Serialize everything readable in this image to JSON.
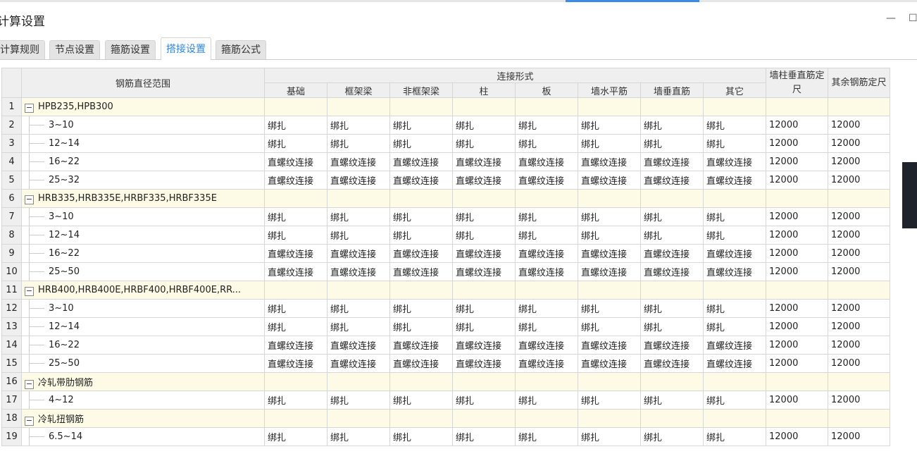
{
  "window": {
    "title": "计算设置",
    "minimize_icon": "minimize-icon",
    "maximize_icon": "maximize-icon"
  },
  "tabs": [
    {
      "label": "计算规则"
    },
    {
      "label": "节点设置"
    },
    {
      "label": "箍筋设置"
    },
    {
      "label": "搭接设置",
      "active": true
    },
    {
      "label": "箍筋公式"
    }
  ],
  "table": {
    "headers": {
      "range": "钢筋直径范围",
      "connection": "连接形式",
      "connection_cols": [
        "基础",
        "框架梁",
        "非框架梁",
        "柱",
        "板",
        "墙水平筋",
        "墙垂直筋",
        "其它"
      ],
      "wall_col": "墙柱垂直筋定尺",
      "other_col": "其余钢筋定尺"
    },
    "rows": [
      {
        "n": "1",
        "group": true,
        "label": "HPB235,HPB300"
      },
      {
        "n": "2",
        "label": "3~10",
        "conn": "绑扎",
        "wall": "12000",
        "other": "12000"
      },
      {
        "n": "3",
        "label": "12~14",
        "conn": "绑扎",
        "wall": "12000",
        "other": "12000"
      },
      {
        "n": "4",
        "label": "16~22",
        "conn": "直螺纹连接",
        "wall": "12000",
        "other": "12000"
      },
      {
        "n": "5",
        "label": "25~32",
        "conn": "直螺纹连接",
        "wall": "12000",
        "other": "12000"
      },
      {
        "n": "6",
        "group": true,
        "label": "HRB335,HRB335E,HRBF335,HRBF335E"
      },
      {
        "n": "7",
        "label": "3~10",
        "conn": "绑扎",
        "wall": "12000",
        "other": "12000"
      },
      {
        "n": "8",
        "label": "12~14",
        "conn": "绑扎",
        "wall": "12000",
        "other": "12000"
      },
      {
        "n": "9",
        "label": "16~22",
        "conn": "直螺纹连接",
        "wall": "12000",
        "other": "12000"
      },
      {
        "n": "10",
        "label": "25~50",
        "conn": "直螺纹连接",
        "wall": "12000",
        "other": "12000"
      },
      {
        "n": "11",
        "group": true,
        "label": "HRB400,HRB400E,HRBF400,HRBF400E,RR..."
      },
      {
        "n": "12",
        "label": "3~10",
        "conn": "绑扎",
        "wall": "12000",
        "other": "12000"
      },
      {
        "n": "13",
        "label": "12~14",
        "conn": "绑扎",
        "wall": "12000",
        "other": "12000"
      },
      {
        "n": "14",
        "label": "16~22",
        "conn": "直螺纹连接",
        "wall": "12000",
        "other": "12000"
      },
      {
        "n": "15",
        "label": "25~50",
        "conn": "直螺纹连接",
        "wall": "12000",
        "other": "12000"
      },
      {
        "n": "16",
        "group": true,
        "label": "冷轧带肋钢筋"
      },
      {
        "n": "17",
        "label": "4~12",
        "conn": "绑扎",
        "wall": "12000",
        "other": "12000"
      },
      {
        "n": "18",
        "group": true,
        "label": "冷轧扭钢筋"
      },
      {
        "n": "19",
        "label": "6.5~14",
        "conn": "绑扎",
        "wall": "12000",
        "other": "12000"
      }
    ]
  },
  "colors": {
    "active_tab": "#2f86e0",
    "group_row_bg": "#fdfbe6",
    "header_bg": "#efefef"
  }
}
